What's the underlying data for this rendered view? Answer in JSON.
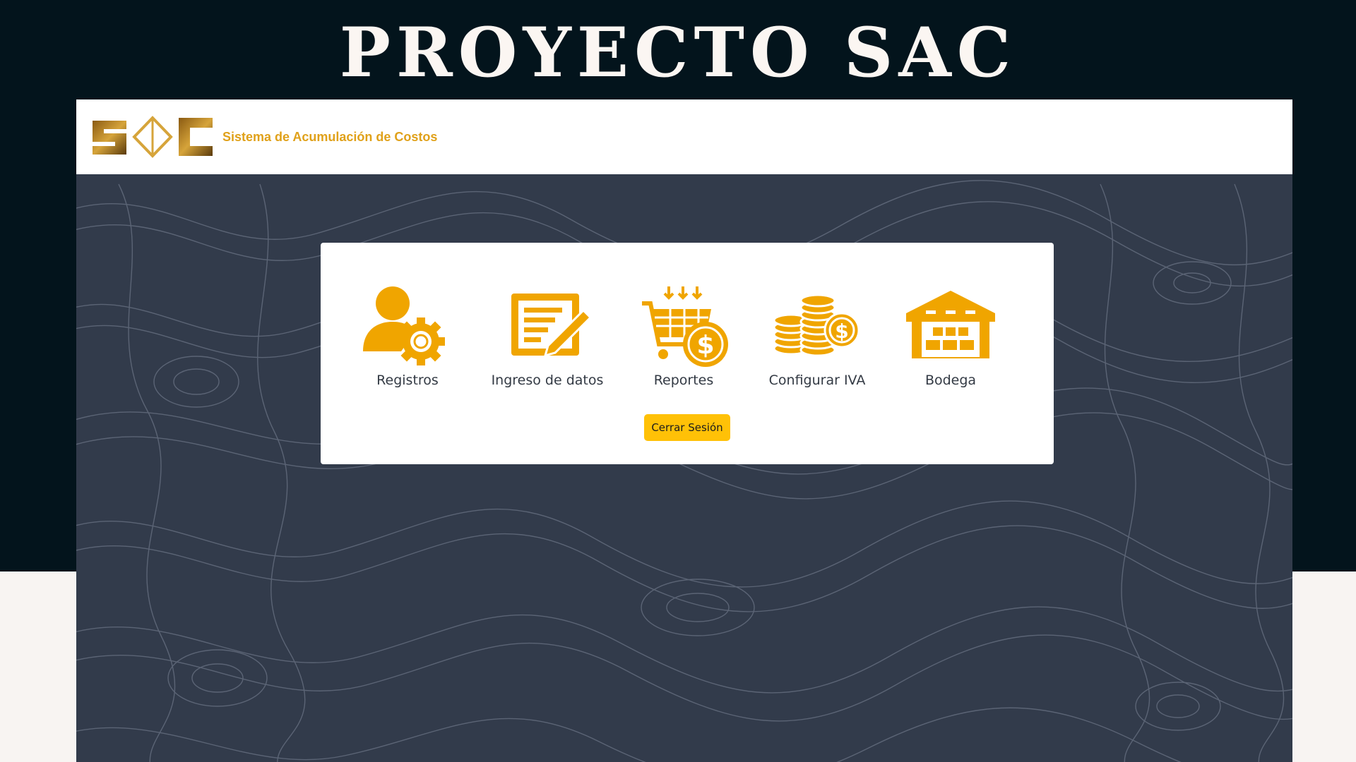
{
  "headline": "PROYECTO SAC",
  "navbar": {
    "logo_text": "SAC",
    "brand_name": "Sistema de Acumulación de Costos"
  },
  "menu": {
    "items": [
      {
        "label": "Registros",
        "icon": "user-gear-icon"
      },
      {
        "label": "Ingreso de datos",
        "icon": "document-edit-icon"
      },
      {
        "label": "Reportes",
        "icon": "cart-dollar-icon"
      },
      {
        "label": "Configurar IVA",
        "icon": "coins-icon"
      },
      {
        "label": "Bodega",
        "icon": "warehouse-icon"
      }
    ],
    "logout_label": "Cerrar Sesión"
  },
  "colors": {
    "accent": "#ffc107",
    "icon": "#f0a500",
    "brand_text": "#e0a11a",
    "background_dark": "#03141c",
    "frame_bg": "#323b4b"
  }
}
